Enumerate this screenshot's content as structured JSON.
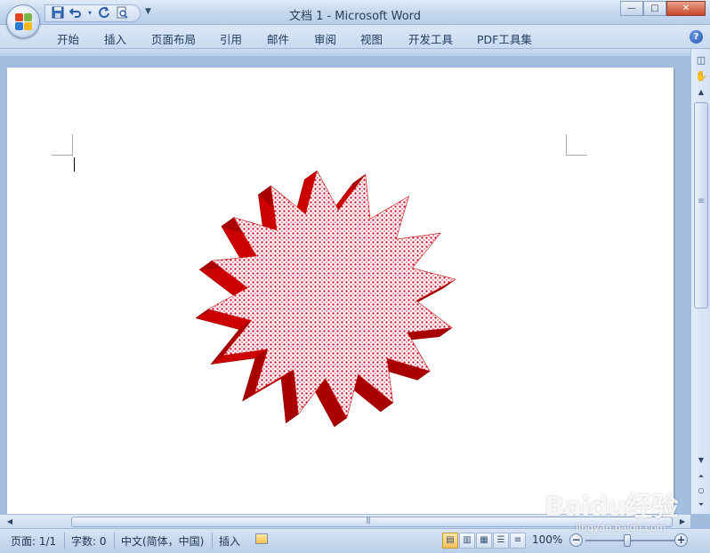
{
  "window": {
    "title": "文档 1 - Microsoft Word",
    "minimize_label": "—",
    "maximize_label": "□",
    "close_label": "✕"
  },
  "quick_access": {
    "items": [
      {
        "name": "save-icon",
        "glyph": "💾"
      },
      {
        "name": "undo-icon",
        "glyph": "↶"
      },
      {
        "name": "redo-icon",
        "glyph": "↻"
      },
      {
        "name": "print-preview-icon",
        "glyph": "🔍"
      }
    ]
  },
  "ribbon": {
    "tabs": [
      "开始",
      "插入",
      "页面布局",
      "引用",
      "邮件",
      "审阅",
      "视图",
      "开发工具",
      "PDF工具集"
    ],
    "help_label": "?"
  },
  "document": {
    "shape": "star-16-point-3d",
    "shape_color": "#cc0000",
    "shape_fill_pattern": "dotted-red"
  },
  "statusbar": {
    "page": "页面: 1/1",
    "word_count": "字数: 0",
    "language": "中文(简体，中国)",
    "mode": "插入",
    "zoom": "100%",
    "zoom_level_percent": 100
  },
  "watermark": {
    "brand": "Baidu经验",
    "url": "jingyan.baidu.com"
  },
  "colors": {
    "accent": "#1d56b1",
    "close": "#c9482c",
    "shape_red": "#cc0000"
  }
}
